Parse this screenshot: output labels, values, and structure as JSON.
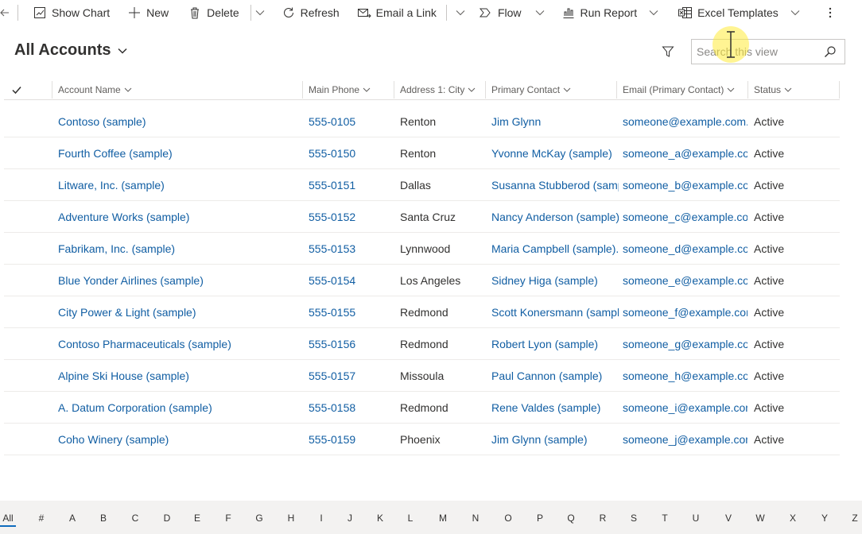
{
  "toolbar": {
    "buttons": [
      {
        "label": "Show Chart",
        "icon": "chart-icon"
      },
      {
        "label": "New",
        "icon": "plus-icon"
      },
      {
        "label": "Delete",
        "icon": "trash-icon"
      },
      {
        "label": "Refresh",
        "icon": "refresh-icon"
      },
      {
        "label": "Email a Link",
        "icon": "email-link-icon"
      },
      {
        "label": "Flow",
        "icon": "flow-icon"
      },
      {
        "label": "Run Report",
        "icon": "report-icon"
      },
      {
        "label": "Excel Templates",
        "icon": "excel-icon"
      }
    ]
  },
  "view": {
    "title": "All Accounts",
    "search_placeholder": "Search this view"
  },
  "grid": {
    "columns": [
      "Account Name",
      "Main Phone",
      "Address 1: City",
      "Primary Contact",
      "Email (Primary Contact)",
      "Status"
    ],
    "rows": [
      [
        "Contoso (sample)",
        "555-0105",
        "Renton",
        "Jim Glynn",
        "someone@example.com...",
        "Active"
      ],
      [
        "Fourth Coffee (sample)",
        "555-0150",
        "Renton",
        "Yvonne McKay (sample)",
        "someone_a@example.cor",
        "Active"
      ],
      [
        "Litware, Inc. (sample)",
        "555-0151",
        "Dallas",
        "Susanna Stubberod (samp",
        "someone_b@example.cor",
        "Active"
      ],
      [
        "Adventure Works (sample)",
        "555-0152",
        "Santa Cruz",
        "Nancy Anderson (sample)",
        "someone_c@example.cor",
        "Active"
      ],
      [
        "Fabrikam, Inc. (sample)",
        "555-0153",
        "Lynnwood",
        "Maria Campbell (sample).",
        "someone_d@example.cor",
        "Active"
      ],
      [
        "Blue Yonder Airlines (sample)",
        "555-0154",
        "Los Angeles",
        "Sidney Higa (sample)",
        "someone_e@example.cor",
        "Active"
      ],
      [
        "City Power & Light (sample)",
        "555-0155",
        "Redmond",
        "Scott Konersmann (sampl",
        "someone_f@example.com",
        "Active"
      ],
      [
        "Contoso Pharmaceuticals (sample)",
        "555-0156",
        "Redmond",
        "Robert Lyon (sample)",
        "someone_g@example.cor",
        "Active"
      ],
      [
        "Alpine Ski House (sample)",
        "555-0157",
        "Missoula",
        "Paul Cannon (sample)",
        "someone_h@example.cor",
        "Active"
      ],
      [
        "A. Datum Corporation (sample)",
        "555-0158",
        "Redmond",
        "Rene Valdes (sample)",
        "someone_i@example.com",
        "Active"
      ],
      [
        "Coho Winery (sample)",
        "555-0159",
        "Phoenix",
        "Jim Glynn (sample)",
        "someone_j@example.com",
        "Active"
      ]
    ]
  },
  "alpha_bar": {
    "letters": [
      "All",
      "#",
      "A",
      "B",
      "C",
      "D",
      "E",
      "F",
      "G",
      "H",
      "I",
      "J",
      "K",
      "L",
      "M",
      "N",
      "O",
      "P",
      "Q",
      "R",
      "S",
      "T",
      "U",
      "V",
      "W",
      "X",
      "Y",
      "Z"
    ],
    "selected": "All"
  },
  "colors": {
    "link": "#115ea3",
    "text": "#323130",
    "header_text": "#605e5c",
    "alpha_bar_bg": "#f3f2f1",
    "cursor_highlight": "#ffeb3b"
  }
}
